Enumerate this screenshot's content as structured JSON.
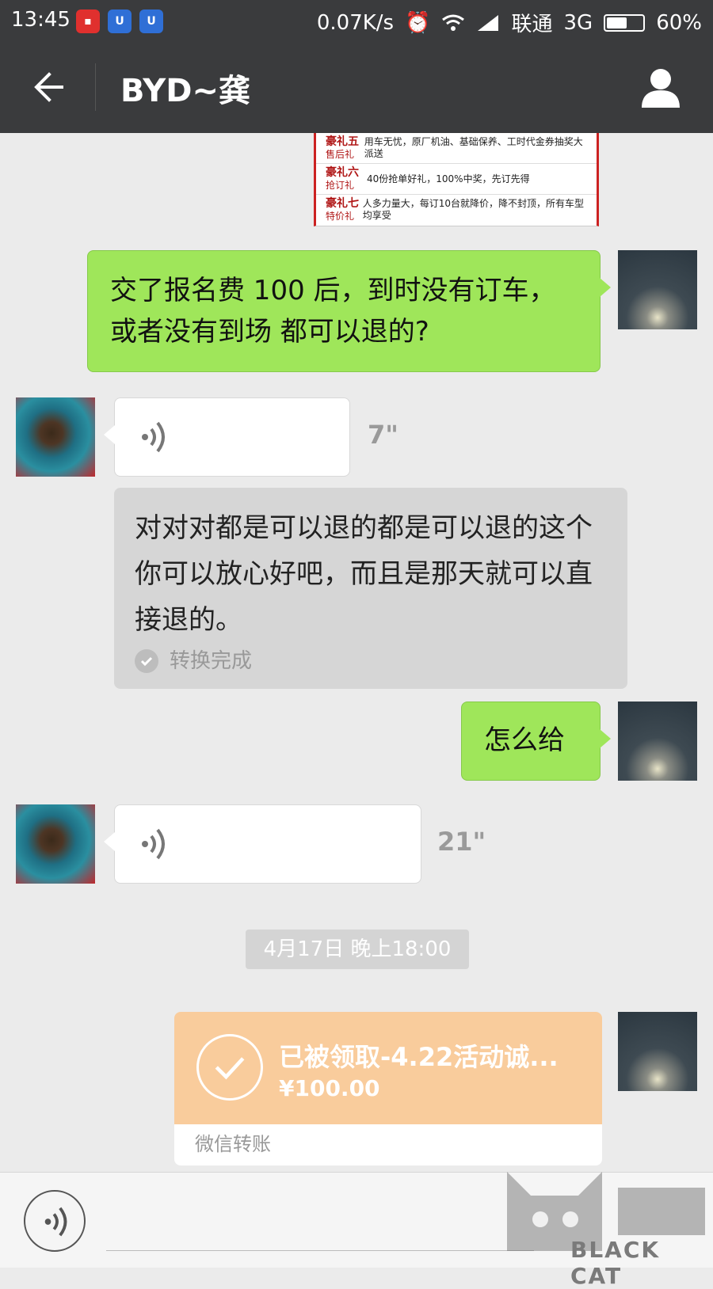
{
  "status_bar": {
    "time": "13:45",
    "speed": "0.07K/s",
    "carrier": "联通",
    "network": "3G",
    "battery": "60%",
    "battery_level": 0.6,
    "icons": [
      "app-notification-icon",
      "baidu-icon",
      "baidu-icon",
      "alarm-icon",
      "wifi-icon",
      "signal-icon",
      "battery-icon"
    ]
  },
  "header": {
    "title": "BYD~龚",
    "back_icon": "arrow-left-icon",
    "profile_icon": "user-icon"
  },
  "poster": {
    "rows": [
      {
        "title": "豪礼五",
        "sub": "售后礼",
        "desc": "用车无忧，原厂机油、基础保养、工时代金券抽奖大派送"
      },
      {
        "title": "豪礼六",
        "sub": "抢订礼",
        "desc": "40份抢单好礼，100%中奖，先订先得"
      },
      {
        "title": "豪礼七",
        "sub": "特价礼",
        "desc": "人多力量大，每订10台就降价，降不封顶，所有车型均享受"
      }
    ]
  },
  "messages": {
    "m1_text": "交了报名费 100 后，到时没有订车，或者没有到场 都可以退的?",
    "voice1_duration": "7\"",
    "transcript_text": "对对对都是可以退的都是可以退的这个你可以放心好吧，而且是那天就可以直接退的。",
    "transcript_status": "转换完成",
    "m2_text": "怎么给",
    "voice2_duration": "21\"",
    "timestamp": "4月17日 晚上18:00",
    "transfer_title": "已被领取-4.22活动诚...",
    "transfer_amount": "¥100.00",
    "transfer_label": "微信转账"
  },
  "watermark": {
    "text": "BLACK CAT"
  },
  "colors": {
    "header_bg": "#3a3b3d",
    "chat_bg": "#ebebeb",
    "my_bubble": "#9fe65a",
    "transfer_bg": "#f9cc9c"
  }
}
